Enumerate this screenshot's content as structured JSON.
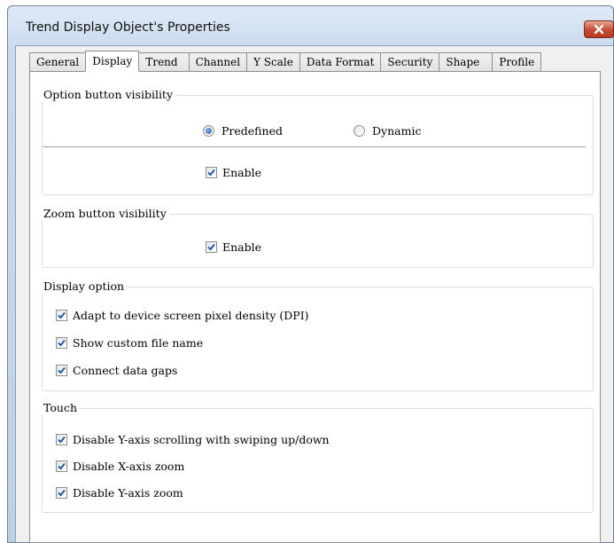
{
  "window": {
    "title": "Trend Display Object's Properties",
    "close_label": "×"
  },
  "tabs": [
    {
      "label": "General",
      "active": false
    },
    {
      "label": "Display",
      "active": true
    },
    {
      "label": "Trend",
      "active": false
    },
    {
      "label": "Channel",
      "active": false
    },
    {
      "label": "Y Scale",
      "active": false
    },
    {
      "label": "Data Format",
      "active": false
    },
    {
      "label": "Security",
      "active": false
    },
    {
      "label": "Shape",
      "active": false
    },
    {
      "label": "Profile",
      "active": false
    }
  ],
  "option_button_visibility": {
    "title": "Option button visibility",
    "radio_predefined": {
      "label": "Predefined",
      "selected": true
    },
    "radio_dynamic": {
      "label": "Dynamic",
      "selected": false
    },
    "enable": {
      "label": "Enable",
      "checked": true
    }
  },
  "zoom_button_visibility": {
    "title": "Zoom button visibility",
    "enable": {
      "label": "Enable",
      "checked": true
    }
  },
  "display_option": {
    "title": "Display option",
    "items": [
      {
        "label": "Adapt to device screen pixel density (DPI)",
        "checked": true
      },
      {
        "label": "Show custom file name",
        "checked": true
      },
      {
        "label": "Connect data gaps",
        "checked": true
      }
    ]
  },
  "touch": {
    "title": "Touch",
    "items": [
      {
        "label": "Disable Y-axis scrolling with swiping up/down",
        "checked": true
      },
      {
        "label": "Disable X-axis zoom",
        "checked": true
      },
      {
        "label": "Disable Y-axis zoom",
        "checked": true
      }
    ]
  },
  "colors": {
    "frame": "#c9daee",
    "close_button": "#c74a33",
    "checkmark": "#1c4f9c",
    "radio_dot": "#1f5ba8"
  }
}
